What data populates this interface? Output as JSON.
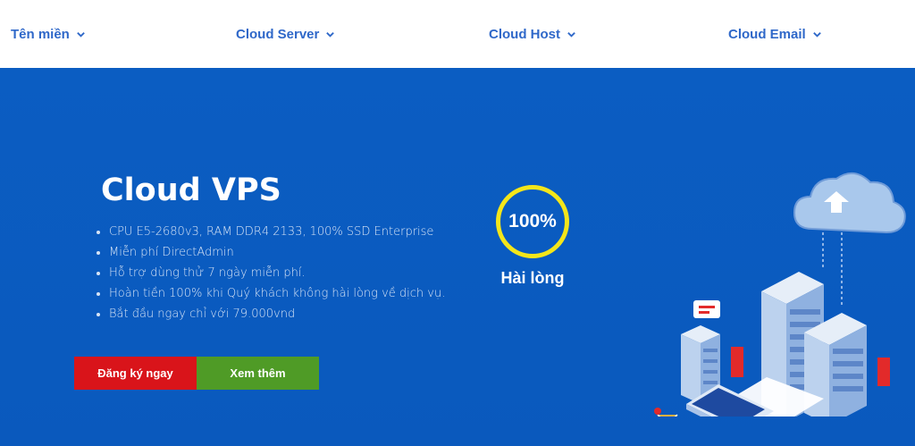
{
  "nav": {
    "items": [
      {
        "label": "Tên miền"
      },
      {
        "label": "Cloud Server"
      },
      {
        "label": "Cloud Host"
      },
      {
        "label": "Cloud Email"
      }
    ]
  },
  "hero": {
    "title": "Cloud VPS",
    "features": [
      "CPU E5-2680v3, RAM DDR4 2133, 100% SSD Enterprise",
      "Miễn phí DirectAdmin",
      "Hỗ trợ dùng thử 7 ngày miễn phí.",
      "Hoàn tiền 100% khi Quý khách không hài lòng về dịch vụ.",
      "Bắt đầu ngay chỉ với 79.000vnd"
    ],
    "buttons": {
      "register": "Đăng ký ngay",
      "more": "Xem thêm"
    },
    "badge": {
      "value": "100%",
      "label": "Hài lòng"
    }
  },
  "colors": {
    "hero_bg": "#0a5cc0",
    "nav_text": "#2f68c9",
    "register_button": "#d9141a",
    "more_button": "#4f9b26",
    "badge_ring": "#f4e61a"
  },
  "icons": {
    "nav_chevron": "chevron-down-icon",
    "illustration": "cloud-server-illustration"
  }
}
